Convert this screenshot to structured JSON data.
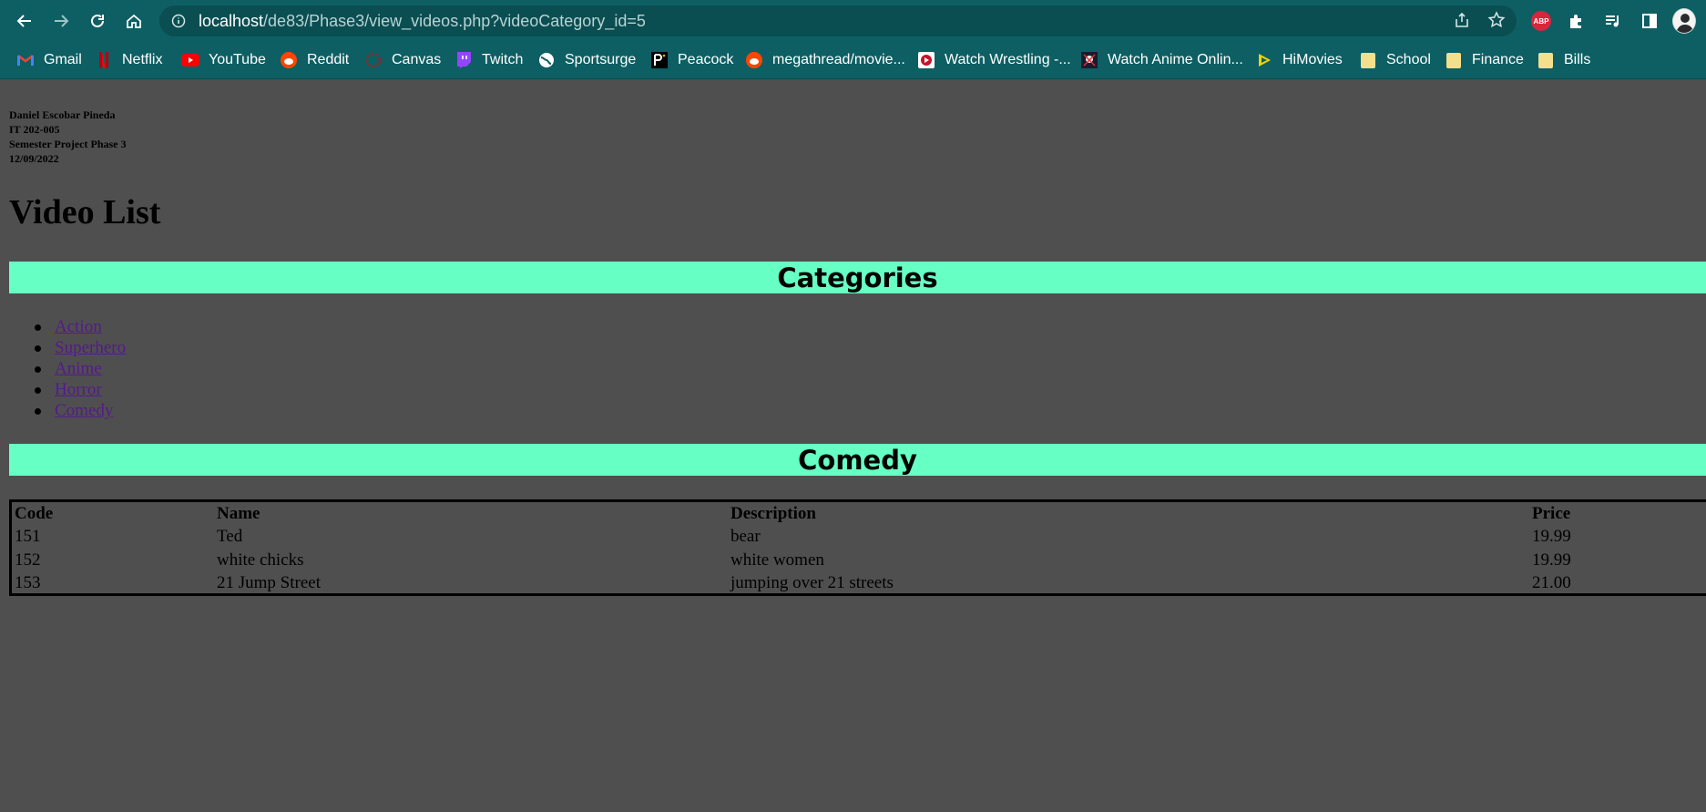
{
  "browser": {
    "url_host": "localhost",
    "url_path": "/de83/Phase3/view_videos.php?videoCategory_id=5",
    "extensions": {
      "adblock_label": "ABP"
    },
    "bookmarks": [
      {
        "label": "Gmail",
        "icon": "gmail-icon"
      },
      {
        "label": "Netflix",
        "icon": "netflix-icon"
      },
      {
        "label": "YouTube",
        "icon": "youtube-icon"
      },
      {
        "label": "Reddit",
        "icon": "reddit-icon"
      },
      {
        "label": "Canvas",
        "icon": "canvas-icon"
      },
      {
        "label": "Twitch",
        "icon": "twitch-icon"
      },
      {
        "label": "Sportsurge",
        "icon": "globe-icon"
      },
      {
        "label": "Peacock",
        "icon": "peacock-icon"
      },
      {
        "label": "megathread/movie...",
        "icon": "reddit-icon"
      },
      {
        "label": "Watch Wrestling -...",
        "icon": "wrestling-icon"
      },
      {
        "label": "Watch Anime Onlin...",
        "icon": "anime-icon"
      },
      {
        "label": "HiMovies",
        "icon": "himovies-icon"
      },
      {
        "label": "School",
        "icon": "folder-icon"
      },
      {
        "label": "Finance",
        "icon": "folder-icon"
      },
      {
        "label": "Bills",
        "icon": "folder-icon"
      }
    ]
  },
  "page": {
    "author_lines": [
      "Daniel Escobar Pineda",
      "IT 202-005",
      "Semester Project Phase 3",
      "12/09/2022"
    ],
    "title": "Video List",
    "categories_heading": "Categories",
    "categories": [
      "Action",
      "Superhero",
      "Anime",
      "Horror",
      "Comedy"
    ],
    "selected_category": "Comedy",
    "table": {
      "headers": [
        "Code",
        "Name",
        "Description",
        "Price"
      ],
      "rows": [
        [
          "151",
          "Ted",
          "bear",
          "19.99"
        ],
        [
          "152",
          "white chicks",
          "white women",
          "19.99"
        ],
        [
          "153",
          "21 Jump Street",
          "jumping over 21 streets",
          "21.00"
        ]
      ]
    }
  },
  "colors": {
    "page_background": "#4f4f4f",
    "banner": "#66ffc4",
    "chrome": "#0d5f63",
    "link_visited": "#551a8b"
  }
}
